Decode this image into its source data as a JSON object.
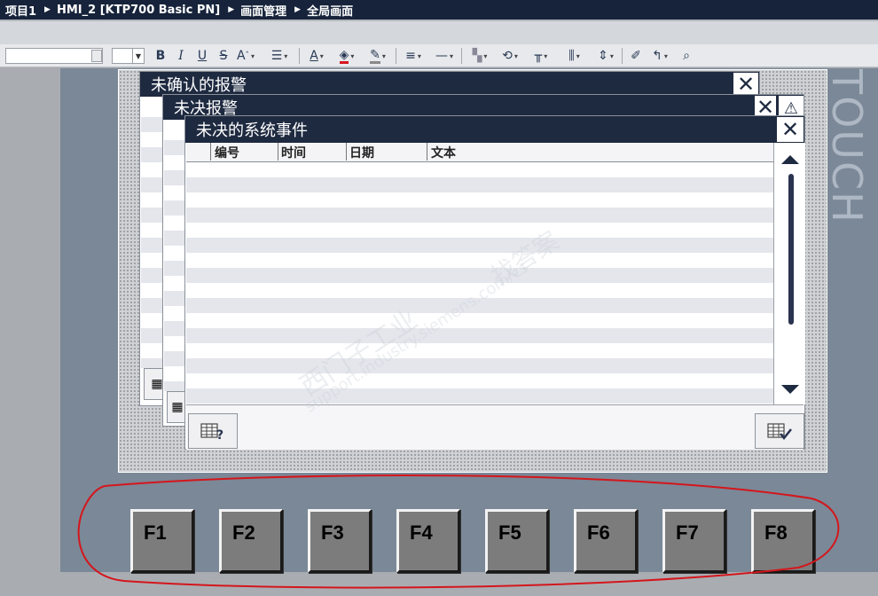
{
  "breadcrumb": {
    "items": [
      "项目1",
      "HMI_2 [KTP700 Basic PN]",
      "画面管理",
      "全局画面"
    ]
  },
  "toolbar": {
    "font_combo_value": "",
    "size_combo_value": "",
    "bold_label": "B",
    "italic_label": "I",
    "underline_label": "U",
    "strike_label": "S"
  },
  "screen": {
    "touch_label": "TOUCH"
  },
  "windows": {
    "unack_title": "未确认的报警",
    "pending_title": "未决报警",
    "system_title": "未决的系统事件",
    "columns": [
      "编号",
      "时间",
      "日期",
      "文本"
    ]
  },
  "fkeys": [
    "F1",
    "F2",
    "F3",
    "F4",
    "F5",
    "F6",
    "F7",
    "F8"
  ],
  "watermark": {
    "line1": "西门子工业",
    "line2": "找答案",
    "line3": "support.industry.siemens.com/cs"
  },
  "colors": {
    "title_bar": "#1e2a40",
    "panel": "#7b8897",
    "fkey": "#7c7c7c",
    "annotation": "#d4161c"
  }
}
